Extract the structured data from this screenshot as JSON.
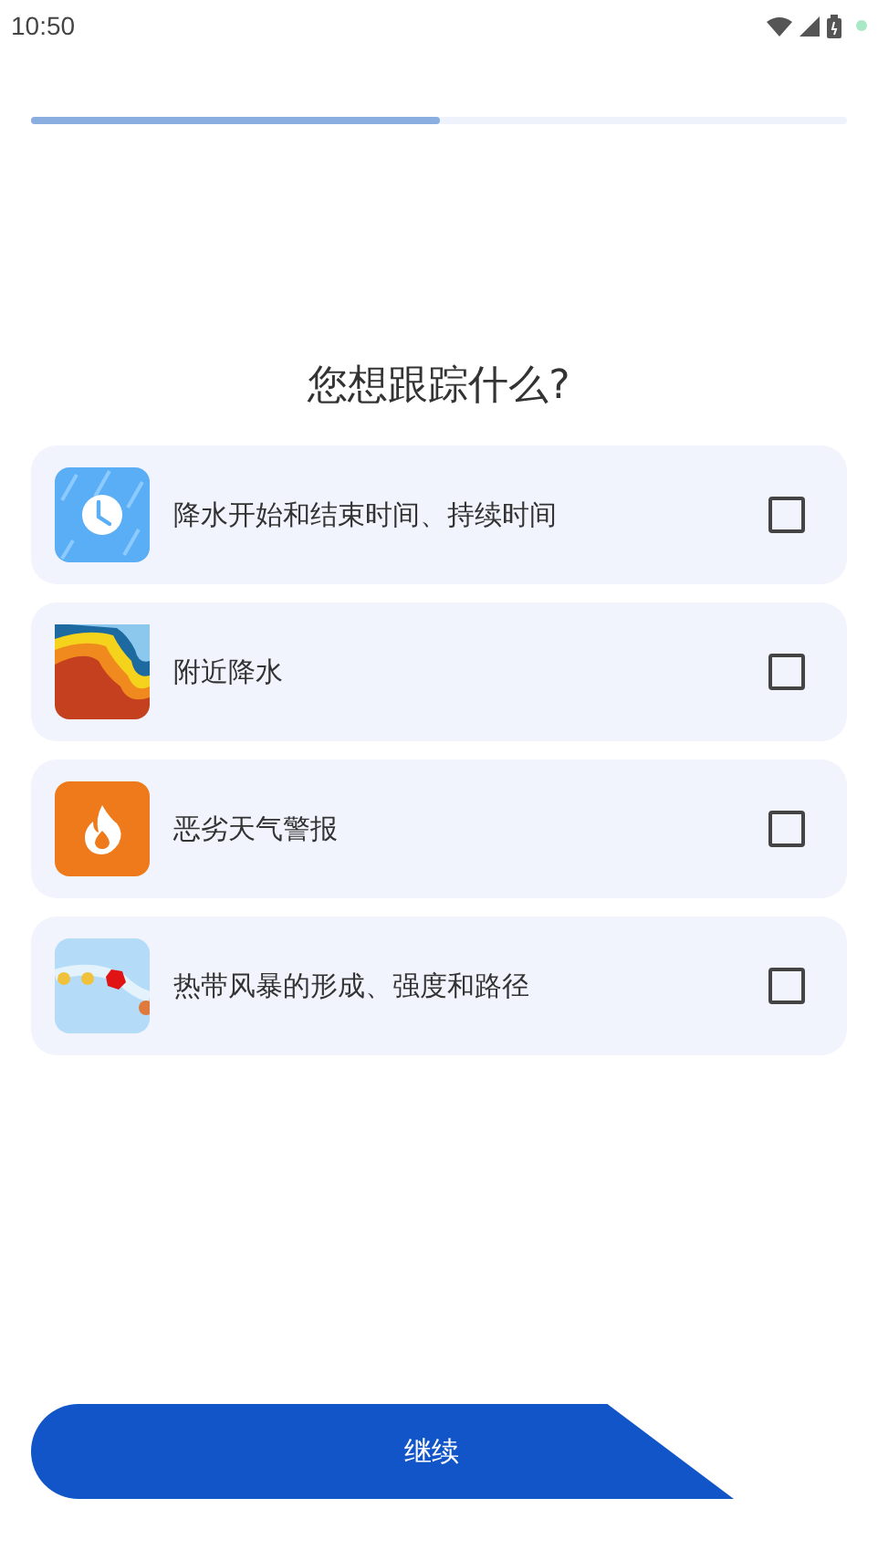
{
  "status_bar": {
    "time": "10:50"
  },
  "progress": {
    "level": 0.5
  },
  "title": "您想跟踪什么?",
  "options": [
    {
      "kind": "rain",
      "label": "降水开始和结束时间、持续时间",
      "checked": false
    },
    {
      "kind": "radar",
      "label": "附近降水",
      "checked": false
    },
    {
      "kind": "alert",
      "label": "恶劣天气警报",
      "checked": false
    },
    {
      "kind": "storm",
      "label": "热带风暴的形成、强度和路径",
      "checked": false
    }
  ],
  "continue_button": "继续"
}
